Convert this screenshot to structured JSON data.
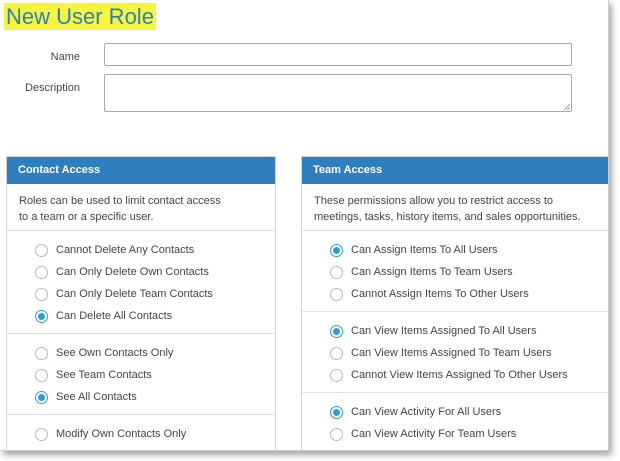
{
  "page": {
    "title": "New User Role"
  },
  "form": {
    "name_label": "Name",
    "name_value": "",
    "description_label": "Description",
    "description_value": ""
  },
  "contact_access": {
    "title": "Contact Access",
    "description_line1": "Roles can be used to limit contact access",
    "description_line2": "to a team or a specific user.",
    "groups": [
      {
        "options": [
          {
            "label": "Cannot Delete Any Contacts",
            "selected": false
          },
          {
            "label": "Can Only Delete Own Contacts",
            "selected": false
          },
          {
            "label": "Can Only Delete Team Contacts",
            "selected": false
          },
          {
            "label": "Can Delete All Contacts",
            "selected": true
          }
        ]
      },
      {
        "options": [
          {
            "label": "See Own Contacts Only",
            "selected": false
          },
          {
            "label": "See Team Contacts",
            "selected": false
          },
          {
            "label": "See All Contacts",
            "selected": true
          }
        ]
      },
      {
        "options": [
          {
            "label": "Modify Own Contacts Only",
            "selected": false
          }
        ]
      }
    ]
  },
  "team_access": {
    "title": "Team Access",
    "description_line1": "These permissions allow you to restrict access to",
    "description_line2": "meetings, tasks, history items, and sales opportunities.",
    "groups": [
      {
        "options": [
          {
            "label": "Can Assign Items To All Users",
            "selected": true
          },
          {
            "label": "Can Assign Items To Team Users",
            "selected": false
          },
          {
            "label": "Cannot Assign Items To Other Users",
            "selected": false
          }
        ]
      },
      {
        "options": [
          {
            "label": "Can View Items Assigned To All Users",
            "selected": true
          },
          {
            "label": "Can View Items Assigned To Team Users",
            "selected": false
          },
          {
            "label": "Cannot View Items Assigned To Other Users",
            "selected": false
          }
        ]
      },
      {
        "options": [
          {
            "label": "Can View Activity For All Users",
            "selected": true
          },
          {
            "label": "Can View Activity For Team Users",
            "selected": false
          }
        ]
      }
    ]
  },
  "colors": {
    "accent": "#2f7fbf",
    "radio_selected": "#2f9bd6",
    "title_highlight": "#f6f53d"
  }
}
